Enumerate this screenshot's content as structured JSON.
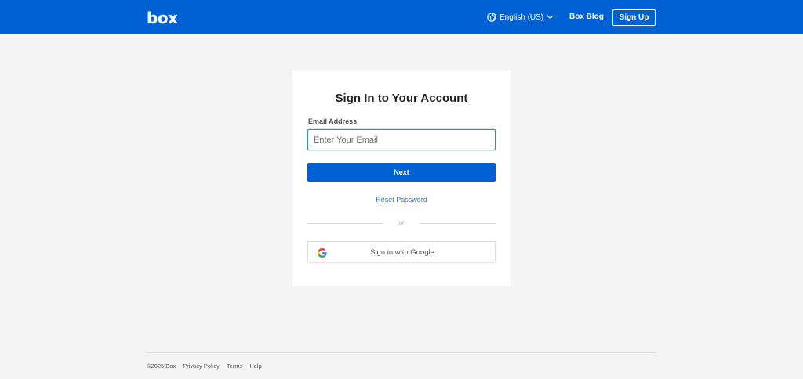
{
  "header": {
    "logo_text": "box",
    "language": "English (US)",
    "blog_label": "Box Blog",
    "signup_label": "Sign Up",
    "bg_color": "#0061d5"
  },
  "card": {
    "title": "Sign In to Your Account",
    "email_label": "Email Address",
    "email_placeholder": "Enter Your Email",
    "email_value": "",
    "next_label": "Next",
    "reset_label": "Reset Password",
    "or_label": "or",
    "google_label": "Sign in with Google",
    "accent_color": "#0061d5"
  },
  "footer": {
    "copyright": "©2025 Box",
    "links": [
      "Privacy Policy",
      "Terms",
      "Help"
    ]
  },
  "icons": {
    "globe": "globe-icon",
    "chevron": "chevron-down-icon",
    "google": "google-icon"
  }
}
